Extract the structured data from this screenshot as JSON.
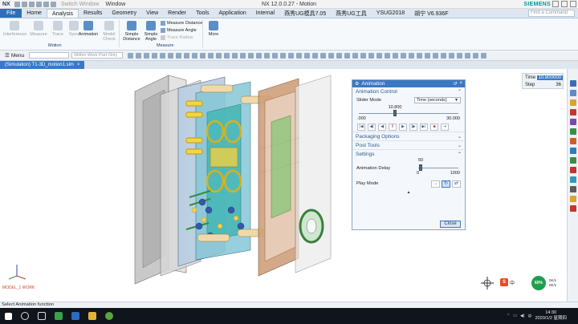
{
  "app": {
    "logo": "NX",
    "title": "NX 12.0.0.27 - Motion",
    "brand": "SIEMENS",
    "switch_window": "Switch Window",
    "window_menu": "Window"
  },
  "tabs": [
    {
      "label": "File"
    },
    {
      "label": "Home"
    },
    {
      "label": "Analysis"
    },
    {
      "label": "Results"
    },
    {
      "label": "Geometry"
    },
    {
      "label": "View"
    },
    {
      "label": "Render"
    },
    {
      "label": "Tools"
    },
    {
      "label": "Application"
    },
    {
      "label": "Internal"
    },
    {
      "label": "燕秀UG模具7.05"
    },
    {
      "label": "燕秀UG工具"
    },
    {
      "label": "YSUG2018"
    },
    {
      "label": "胡宁 V6.936F"
    }
  ],
  "command_search_placeholder": "Find a Command",
  "ribbon": {
    "motion_buttons": [
      {
        "label": "Interference"
      },
      {
        "label": "Measure"
      },
      {
        "label": "Trace"
      },
      {
        "label": "Sync"
      },
      {
        "label": "Animation"
      },
      {
        "label": "Model Check"
      }
    ],
    "motion_group": "Motion",
    "measure_buttons": [
      {
        "label": "Simple Distance"
      },
      {
        "label": "Simple Angle"
      }
    ],
    "measure_small": [
      {
        "label": "Measure Distance"
      },
      {
        "label": "Measure Angle"
      },
      {
        "label": "Trace Radius"
      }
    ],
    "measure_group": "Measure",
    "more": "More"
  },
  "toolbar": {
    "menu": "Menu",
    "filter_placeholder": "",
    "scope": "Within Work Part Only"
  },
  "document_tab": "(Simulation) T1-3D_motion1.sim",
  "readout": {
    "time_label": "Time",
    "time_value": "10.800000",
    "step_label": "Step",
    "step_value": "36"
  },
  "dialog": {
    "title": "Animation",
    "animation_control": "Animation Control",
    "slider_mode_label": "Slider Mode",
    "slider_mode_value": "Time (seconds)",
    "slider_value": "10.800",
    "slider_fraction": 0.36,
    "slider_min": ".000",
    "slider_max": "30.000",
    "packaging_options": "Packaging Options",
    "post_tools": "Post Tools",
    "settings": "Settings",
    "animation_delay_label": "Animation Delay",
    "delay_value": "50",
    "delay_fraction": 0.05,
    "delay_min": "0",
    "delay_max": "1000",
    "play_mode_label": "Play Mode",
    "close": "Close"
  },
  "status_text": "Select Animation function",
  "watermark": "MODEL_1 WORK",
  "tray": {
    "ime": "中",
    "net_percent": "60%",
    "net_up": "0K/s",
    "net_down": "0K/s",
    "time": "14:30",
    "date": "2020/1/2 星期四"
  }
}
